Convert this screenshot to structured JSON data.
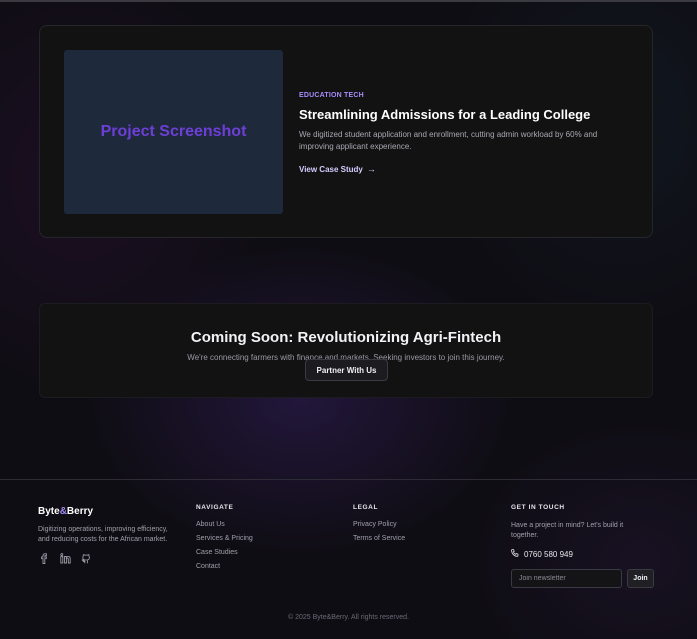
{
  "case_study": {
    "screenshot_label": "Project Screenshot",
    "category": "EDUCATION TECH",
    "title": "Streamlining Admissions for a Leading College",
    "description": "We digitized student application and enrollment, cutting admin workload by 60% and improving applicant experience.",
    "link_label": "View Case Study",
    "link_icon": "arrow-right-icon"
  },
  "coming_soon": {
    "title": "Coming Soon: Revolutionizing Agri-Fintech",
    "description": "We're connecting farmers with finance and markets. Seeking investors to join this journey.",
    "button_label": "Partner With Us"
  },
  "footer": {
    "brand_name": "Byte",
    "brand_amp": "&",
    "brand_name_end": "Berry",
    "brand_description": "Digitizing operations, improving efficiency, and reducing costs for the African market.",
    "socials": [
      "facebook-icon",
      "linkedin-icon",
      "github-icon"
    ],
    "navigate": {
      "heading": "NAVIGATE",
      "links": [
        "About Us",
        "Services & Pricing",
        "Case Studies",
        "Contact"
      ]
    },
    "legal": {
      "heading": "LEGAL",
      "links": [
        "Privacy Policy",
        "Terms of Service"
      ]
    },
    "contact": {
      "heading": "GET IN TOUCH",
      "description": "Have a project in mind? Let's build it together.",
      "phone": "0760 580 949",
      "newsletter_placeholder": "Join newsletter",
      "join_label": "Join"
    },
    "copyright": "© 2025 Byte&Berry. All rights reserved."
  },
  "colors": {
    "accent": "#a78bfa",
    "screenshot_text": "#6d3fd6",
    "card_bg": "#121212"
  }
}
